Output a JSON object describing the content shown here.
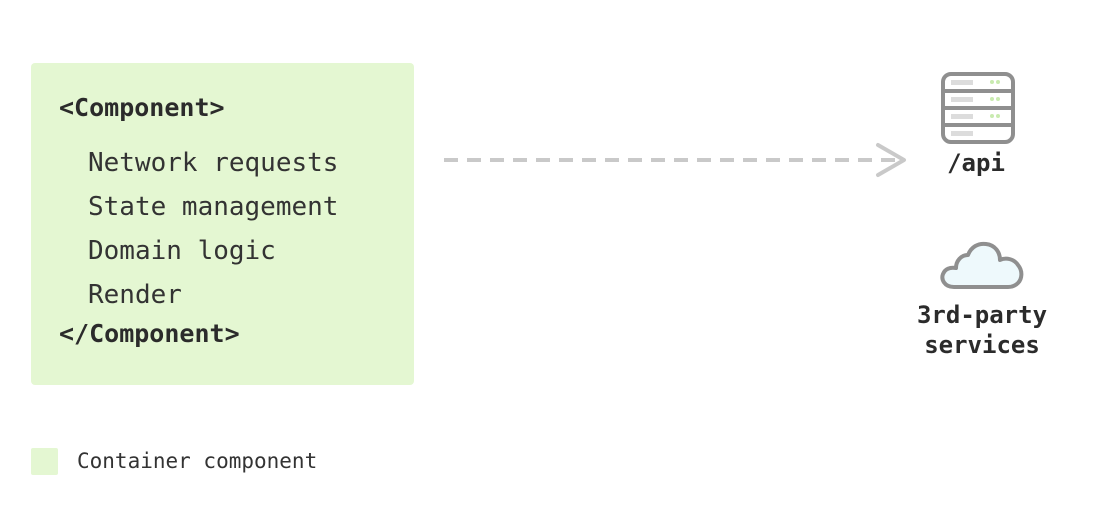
{
  "component": {
    "open_tag": "<Component>",
    "close_tag": "</Component>",
    "responsibilities": [
      "Network requests",
      "State management",
      "Domain logic",
      "Render"
    ]
  },
  "targets": {
    "api": {
      "label": "/api",
      "icon": "server-icon"
    },
    "services": {
      "label_line1": "3rd-party",
      "label_line2": "services",
      "icon": "cloud-icon"
    }
  },
  "legend": {
    "label": "Container component",
    "color": "#e4f7d2"
  },
  "colors": {
    "container_fill": "#e4f7d2",
    "arrow": "#c9c9c9",
    "icon_stroke": "#8f8f8f",
    "cloud_fill": "#eef9fc",
    "server_led": "#c9ebb0"
  }
}
